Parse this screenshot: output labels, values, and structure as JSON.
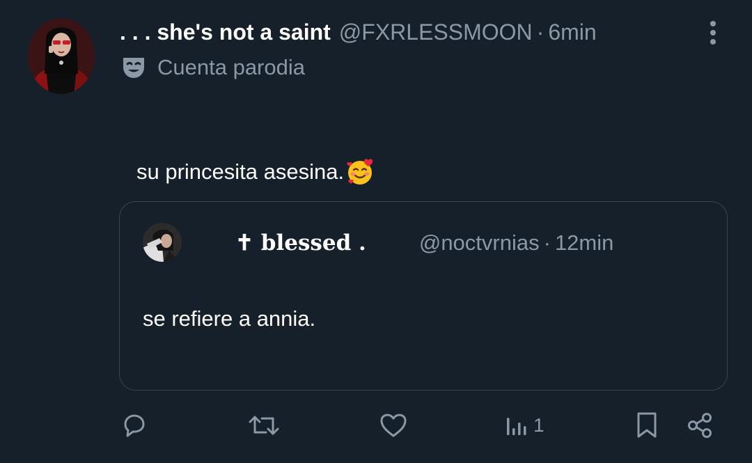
{
  "tweet": {
    "author": {
      "display_name": ". . . she's not a saint",
      "handle": "@FXRLESSMOON",
      "avatar_icon": "profile-photo"
    },
    "separator": "·",
    "time": "6min",
    "parody_label": "Cuenta parodia",
    "parody_icon": "theater-mask-icon",
    "text": "su princesita asesina.",
    "emoji": "smiling-face-with-hearts"
  },
  "quote": {
    "author": {
      "display_name": "✝ blessed .",
      "handle": "@noctvrnias"
    },
    "separator": "·",
    "time": "12min",
    "text": "se refiere a annia."
  },
  "actions": {
    "reply_icon": "reply-icon",
    "retweet_icon": "retweet-icon",
    "like_icon": "heart-icon",
    "views_icon": "views-chart-icon",
    "views_count": "1",
    "bookmark_icon": "bookmark-icon",
    "share_icon": "share-icon"
  },
  "colors": {
    "background": "#15202b",
    "primary_text": "#ffffff",
    "secondary_text": "#8b98a5",
    "border": "#38444d"
  }
}
